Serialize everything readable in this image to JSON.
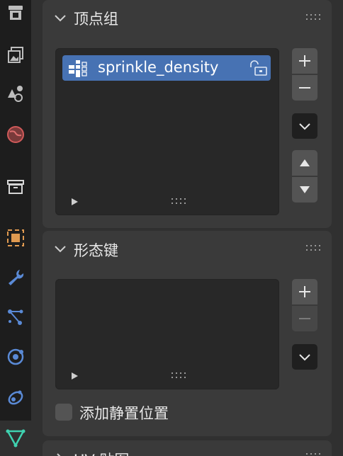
{
  "panels": {
    "vertex_groups": {
      "title": "顶点组",
      "items": [
        {
          "name": "sprinkle_density",
          "selected": true,
          "icon": "vertex-group-icon",
          "lock_icon": "unlock-icon"
        }
      ],
      "buttons": [
        "plus-icon",
        "minus-icon",
        "chevron-down-icon",
        "triangle-up-icon",
        "triangle-down-icon"
      ]
    },
    "shape_keys": {
      "title": "形态键",
      "items": [],
      "buttons": [
        "plus-icon",
        "minus-icon",
        "chevron-down-icon"
      ],
      "checkbox_label": "添加静置位置",
      "checkbox_checked": false
    },
    "uv_maps": {
      "title": "UV 贴图"
    }
  },
  "sidebar_tabs": [
    "render-icon",
    "output-icon",
    "scene-icon",
    "world-icon",
    "collection-icon",
    "object-icon",
    "modifier-icon",
    "particles-icon",
    "physics-icon",
    "constraints-icon",
    "object-data-icon"
  ],
  "colors": {
    "accent": "#4772b3",
    "panel": "#3a3a3a",
    "list": "#282828",
    "button": "#545454",
    "tabstrip": "#1d1d1d",
    "active_tab_icon": "#3fd2b0"
  }
}
